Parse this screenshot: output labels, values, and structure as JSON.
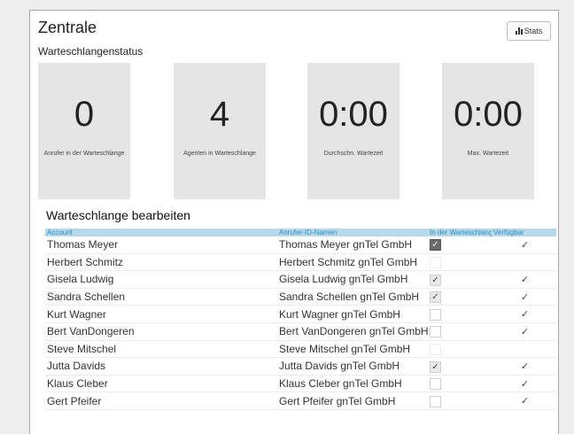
{
  "header": {
    "title": "Zentrale",
    "subtitle": "Warteschlangenstatus",
    "stats_label": "Stats",
    "stats_icon": "bar-chart-icon"
  },
  "cards": [
    {
      "value": "0",
      "label": "Anrufer in der Warteschlange"
    },
    {
      "value": "4",
      "label": "Agenten in Warteschlange"
    },
    {
      "value": "0:00",
      "label": "Durchschn. Wartezeit"
    },
    {
      "value": "0:00",
      "label": "Max. Wartezeit"
    }
  ],
  "queue": {
    "title": "Warteschlange bearbeiten",
    "columns": [
      "Account",
      "Anrufer-ID-Namen",
      "In der Warteschlange",
      "Verfügbar"
    ],
    "rows": [
      {
        "account": "Thomas Meyer",
        "caller_id": "Thomas Meyer gnTel GmbH",
        "in_queue": true,
        "available": true
      },
      {
        "account": "Herbert Schmitz",
        "caller_id": "Herbert Schmitz gnTel GmbH",
        "in_queue": false,
        "available": false
      },
      {
        "account": "Gisela Ludwig",
        "caller_id": "Gisela Ludwig gnTel GmbH",
        "in_queue": true,
        "available": true
      },
      {
        "account": "Sandra Schellen",
        "caller_id": "Sandra Schellen gnTel GmbH",
        "in_queue": true,
        "available": true
      },
      {
        "account": "Kurt Wagner",
        "caller_id": "Kurt Wagner gnTel GmbH",
        "in_queue": false,
        "available": true
      },
      {
        "account": "Bert VanDongeren",
        "caller_id": "Bert VanDongeren gnTel GmbH",
        "in_queue": false,
        "available": true
      },
      {
        "account": "Steve Mitschel",
        "caller_id": "Steve Mitschel gnTel GmbH",
        "in_queue": false,
        "available": false
      },
      {
        "account": "Jutta Davids",
        "caller_id": "Jutta Davids gnTel GmbH",
        "in_queue": true,
        "available": true
      },
      {
        "account": "Klaus Cleber",
        "caller_id": "Klaus Cleber gnTel GmbH",
        "in_queue": false,
        "available": true
      },
      {
        "account": "Gert Pfeifer",
        "caller_id": "Gert Pfeifer gnTel GmbH",
        "in_queue": false,
        "available": true
      }
    ]
  },
  "colors": {
    "header_bg": "#b7d9ea",
    "header_text": "#2a8fc4",
    "card_bg": "#e5e5e5",
    "page_bg": "#eeeeee"
  }
}
